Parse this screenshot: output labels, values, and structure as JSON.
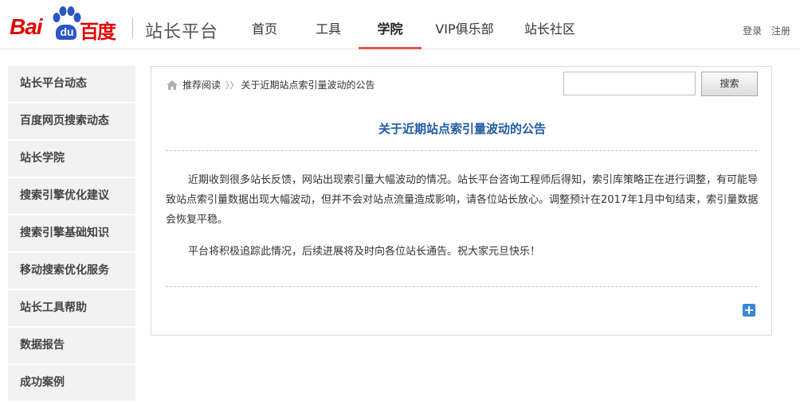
{
  "header": {
    "logo": {
      "bai": "Bai",
      "du": "du",
      "baidu_cn": "百度"
    },
    "site_name": "站长平台",
    "nav": [
      {
        "label": "首页",
        "active": false
      },
      {
        "label": "工具",
        "active": false
      },
      {
        "label": "学院",
        "active": true
      },
      {
        "label": "VIP俱乐部",
        "active": false
      },
      {
        "label": "站长社区",
        "active": false
      }
    ],
    "login": "登录",
    "register": "注册"
  },
  "sidebar": {
    "items": [
      {
        "label": "站长平台动态"
      },
      {
        "label": "百度网页搜索动态"
      },
      {
        "label": "站长学院"
      },
      {
        "label": "搜索引擎优化建议"
      },
      {
        "label": "搜索引擎基础知识"
      },
      {
        "label": "移动搜索优化服务"
      },
      {
        "label": "站长工具帮助"
      },
      {
        "label": "数据报告"
      },
      {
        "label": "成功案例"
      }
    ]
  },
  "main": {
    "breadcrumb": {
      "parent": "推荐阅读",
      "separator": "〉〉",
      "current": "关于近期站点索引量波动的公告"
    },
    "search": {
      "value": "",
      "button_label": "搜索"
    },
    "title": "关于近期站点索引量波动的公告",
    "paragraphs": [
      "近期收到很多站长反馈，网站出现索引量大幅波动的情况。站长平台咨询工程师后得知，索引库策略正在进行调整，有可能导致站点索引量数据出现大幅波动，但并不会对站点流量造成影响，请各位站长放心。调整预计在2017年1月中旬结束，索引量数据会恢复平稳。",
      "平台将积极追踪此情况，后续进展将及时向各位站长通告。祝大家元旦快乐！"
    ]
  },
  "colors": {
    "brand_red": "#e10602",
    "brand_blue": "#2b56c6",
    "nav_active_underline": "#e85546",
    "title_blue": "#1e5aa8",
    "sidebar_bg": "#f2f2f2"
  },
  "icons": {
    "home": "home-icon",
    "expand": "plus-icon"
  }
}
